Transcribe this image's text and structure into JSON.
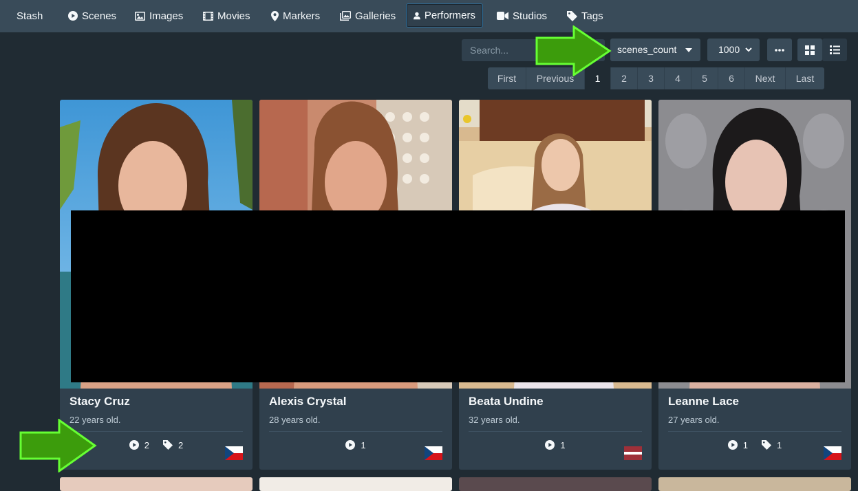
{
  "navbar": {
    "brand": "Stash",
    "items": [
      {
        "label": "Scenes",
        "icon": "play-circle-icon"
      },
      {
        "label": "Images",
        "icon": "image-icon"
      },
      {
        "label": "Movies",
        "icon": "film-icon"
      },
      {
        "label": "Markers",
        "icon": "map-marker-icon"
      },
      {
        "label": "Galleries",
        "icon": "images-icon"
      },
      {
        "label": "Performers",
        "icon": "user-icon",
        "active": true
      },
      {
        "label": "Studios",
        "icon": "video-icon"
      },
      {
        "label": "Tags",
        "icon": "tag-icon"
      }
    ]
  },
  "toolbar": {
    "search_placeholder": "Search...",
    "sort_by": "scenes_count",
    "per_page": "1000",
    "more_icon": "ellipsis-icon",
    "view_modes": [
      "grid-view-icon",
      "list-view-icon"
    ]
  },
  "pagination": {
    "first": "First",
    "previous": "Previous",
    "pages": [
      "1",
      "2",
      "3",
      "4",
      "5",
      "6"
    ],
    "current": "1",
    "next": "Next",
    "last": "Last"
  },
  "performers": [
    {
      "name": "Stacy Cruz",
      "age": "22 years old.",
      "scenes": "2",
      "tags": "2",
      "country_flag": "czech-flag"
    },
    {
      "name": "Alexis Crystal",
      "age": "28 years old.",
      "scenes": "1",
      "country_flag": "czech-flag"
    },
    {
      "name": "Beata Undine",
      "age": "32 years old.",
      "scenes": "1",
      "country_flag": "latvia-flag"
    },
    {
      "name": "Leanne Lace",
      "age": "27 years old.",
      "scenes": "1",
      "tags": "1",
      "country_flag": "czech-flag"
    }
  ],
  "colors": {
    "background": "#202b33",
    "navbar": "#394b59",
    "card": "#30404d",
    "highlight_arrow": "#3c9c0c",
    "arrow_outline": "#66ff33"
  }
}
